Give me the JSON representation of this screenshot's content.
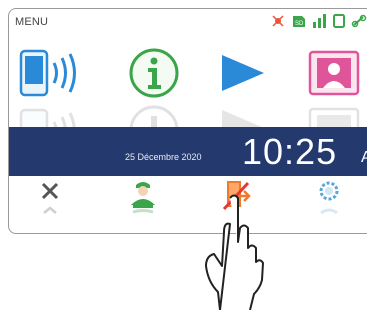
{
  "header": {
    "menu_label": "MENU"
  },
  "status_icons": [
    "no-sound-icon",
    "sd-card-icon",
    "signal-strength-icon",
    "device-icon",
    "link-icon"
  ],
  "menu_icons": [
    "intercom-icon",
    "information-icon",
    "play-icon",
    "profile-icon"
  ],
  "clock": {
    "date": "25 Décembre 2020",
    "time": "10:25",
    "ampm": "AM"
  },
  "bottom_icons": [
    "close-icon",
    "guard-icon",
    "exit-icon",
    "settings-icon"
  ],
  "colors": {
    "bar": "#24396e",
    "accent_green": "#3aa54a",
    "accent_blue": "#2b8ad8",
    "accent_pink": "#e0559a",
    "accent_orange": "#f07a2a"
  }
}
